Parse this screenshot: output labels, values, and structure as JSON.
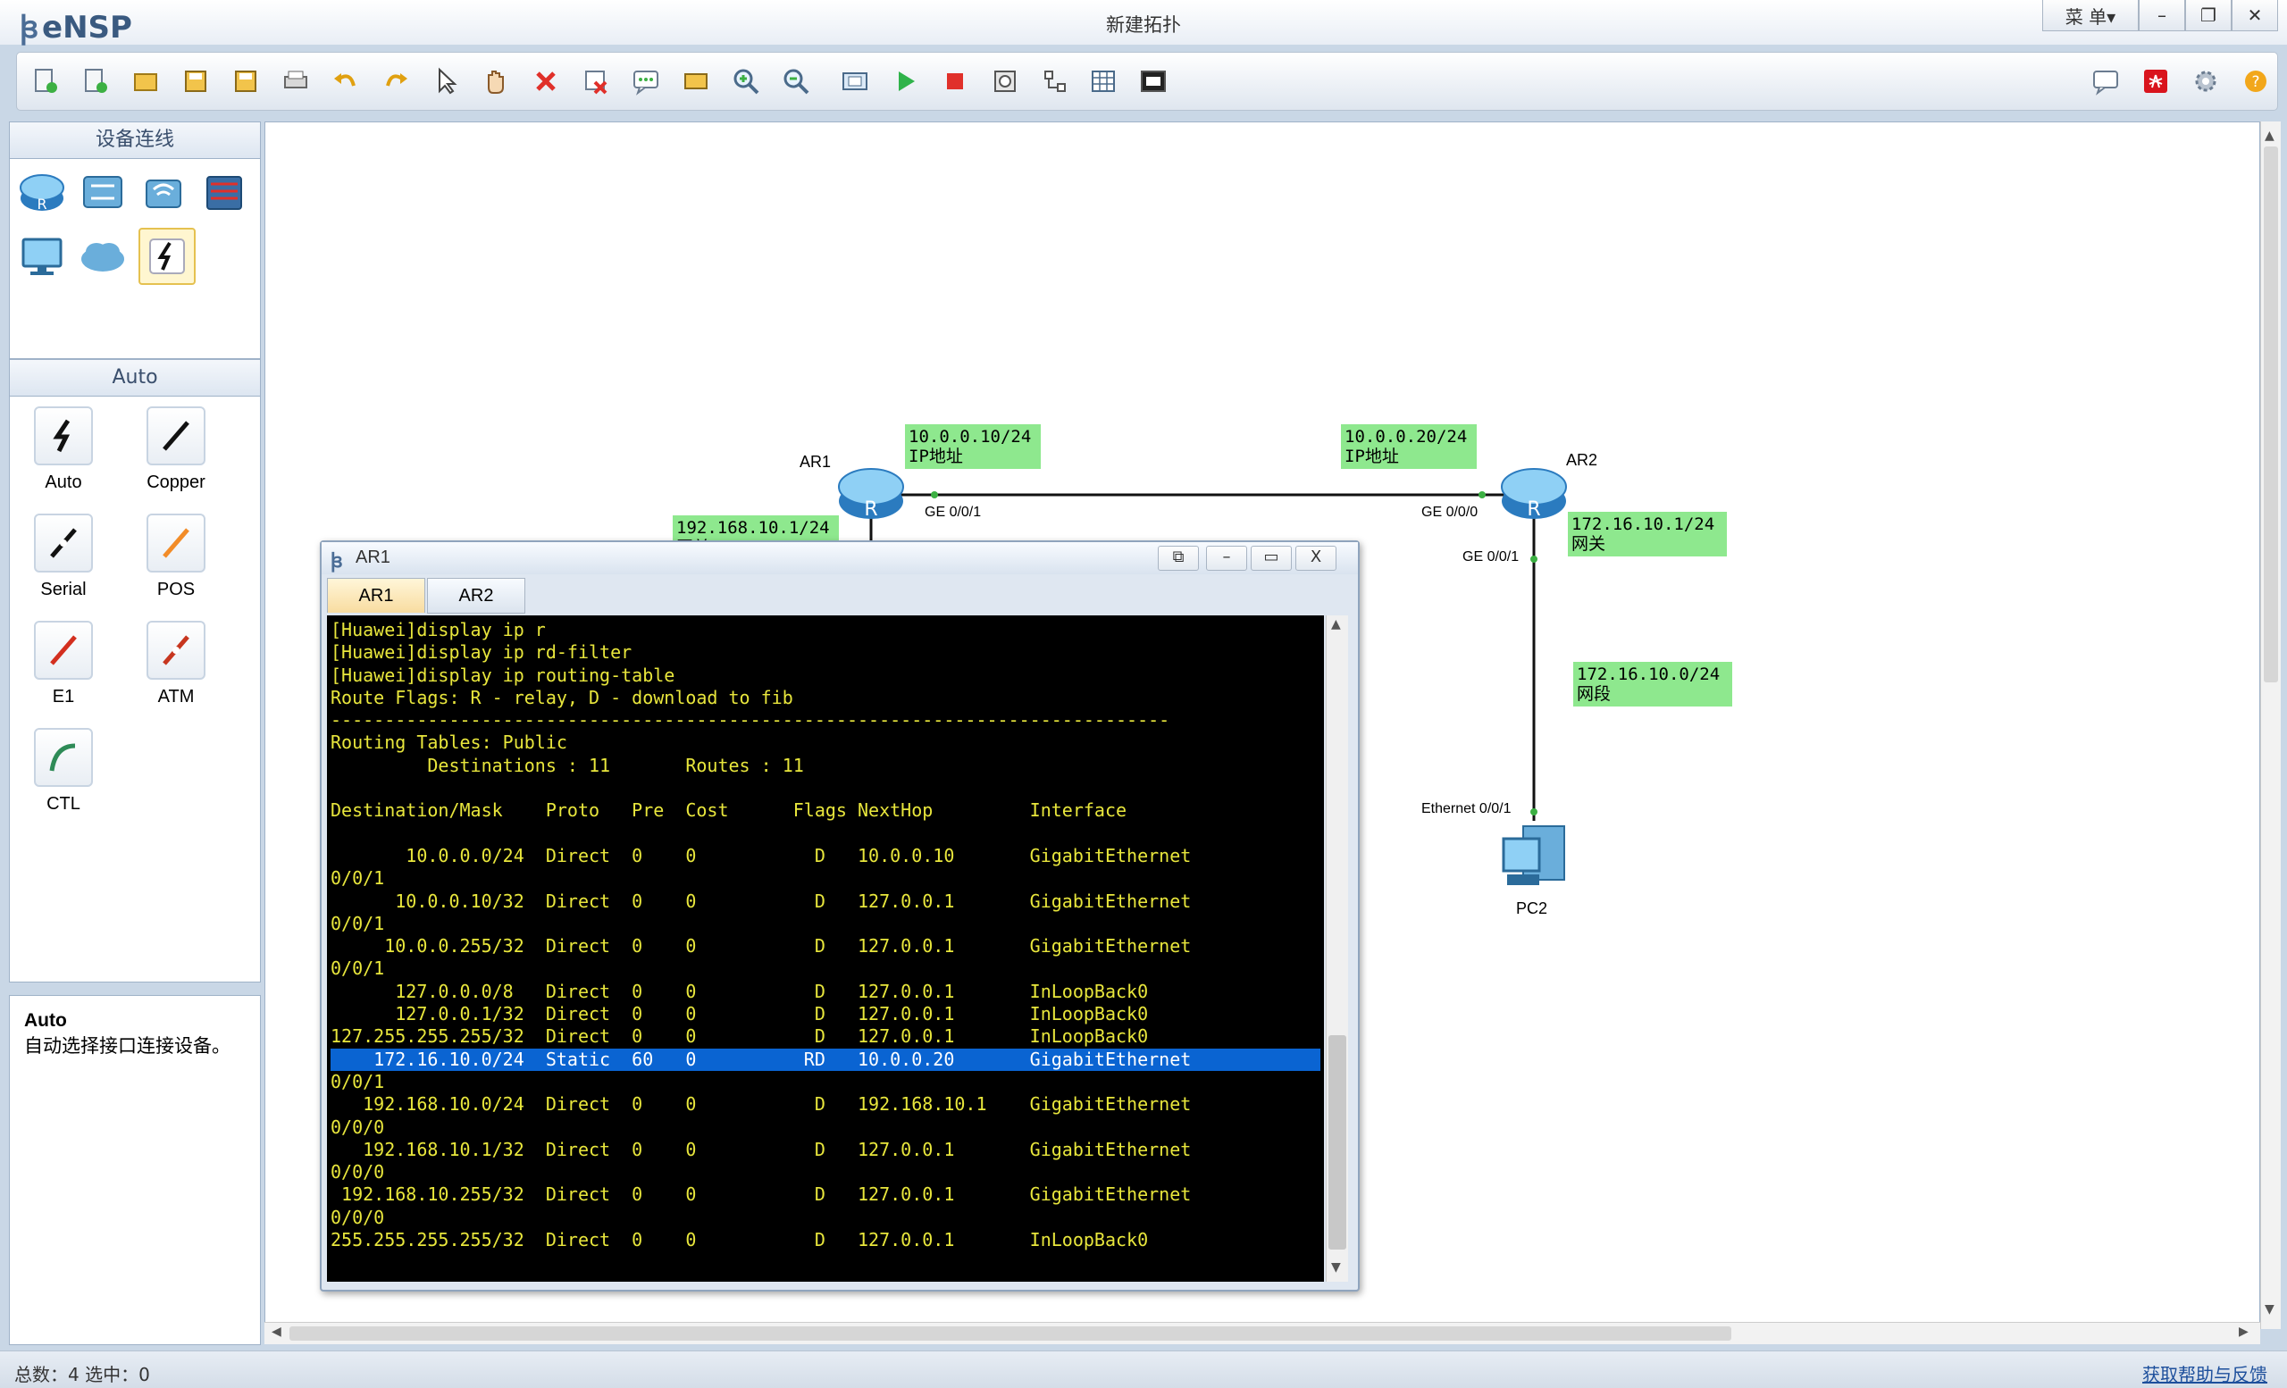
{
  "app": {
    "logo_text": "eNSP",
    "window_title": "新建拓扑",
    "menu_label": "菜 单▾",
    "minimize": "–",
    "restore": "❐",
    "close": "✕"
  },
  "toolbar": {
    "icons": [
      "new-topology-icon",
      "new-example-icon",
      "open-icon",
      "save-icon",
      "save-as-icon",
      "print-icon",
      "undo-icon",
      "redo-icon",
      "select-icon",
      "pan-hand-icon",
      "delete-icon",
      "delete-link-icon",
      "text-annotation-icon",
      "rectangle-icon",
      "zoom-in-icon",
      "zoom-out-icon",
      "fit-view-icon",
      "start-device-icon",
      "stop-device-icon",
      "capture-icon",
      "topology-icon",
      "grid-icon",
      "screenshot-icon",
      "chat-icon",
      "huawei-icon",
      "settings-icon",
      "help-icon"
    ]
  },
  "left_panel": {
    "device_header": "设备连线",
    "device_icons": [
      "router-icon",
      "switch-icon",
      "wlan-icon",
      "firewall-icon",
      "pc-icon",
      "cloud-icon",
      "cable-icon"
    ],
    "auto_header": "Auto",
    "cables": [
      {
        "label": "Auto",
        "icon": "auto-cable-icon",
        "color": "#111111"
      },
      {
        "label": "Copper",
        "icon": "copper-cable-icon",
        "color": "#111111"
      },
      {
        "label": "Serial",
        "icon": "serial-cable-icon",
        "color": "#111111"
      },
      {
        "label": "POS",
        "icon": "pos-cable-icon",
        "color": "#f28c28"
      },
      {
        "label": "E1",
        "icon": "e1-cable-icon",
        "color": "#d32f1f"
      },
      {
        "label": "ATM",
        "icon": "atm-cable-icon",
        "color": "#c7361f"
      },
      {
        "label": "CTL",
        "icon": "ctl-cable-icon",
        "color": "#2e8b57"
      }
    ],
    "desc_title": "Auto",
    "desc_text": "自动选择接口连接设备。"
  },
  "topology": {
    "devices": [
      {
        "name": "AR1",
        "icon": "router-icon"
      },
      {
        "name": "AR2",
        "icon": "router-icon"
      },
      {
        "name": "PC2",
        "icon": "pc-icon"
      }
    ],
    "labels": {
      "ar1_ip_line1": "10.0.0.10/24",
      "ar1_ip_line2": "IP地址",
      "ar2_ip_line1": "10.0.0.20/24",
      "ar2_ip_line2": "IP地址",
      "ar1_lan_line1": "192.168.10.1/24",
      "ar1_lan_line2": "网关",
      "ar2_gw_line1": "172.16.10.1/24",
      "ar2_gw_line2": "网关",
      "net_line1": "172.16.10.0/24",
      "net_line2": "网段"
    },
    "ports": {
      "ar1_ge001": "GE 0/0/1",
      "ar2_ge000": "GE 0/0/0",
      "ar2_ge001": "GE 0/0/1",
      "pc2_eth": "Ethernet 0/0/1"
    },
    "label_color": "#8ee88e"
  },
  "terminal": {
    "title": "AR1",
    "tabs": [
      "AR1",
      "AR2"
    ],
    "active_tab": "AR1",
    "lines": [
      "[Huawei]display ip r",
      "[Huawei]display ip rd-filter",
      "[Huawei]display ip routing-table",
      "Route Flags: R - relay, D - download to fib",
      "------------------------------------------------------------------------------",
      "Routing Tables: Public",
      "         Destinations : 11       Routes : 11",
      "",
      "Destination/Mask    Proto   Pre  Cost      Flags NextHop         Interface",
      "",
      "       10.0.0.0/24  Direct  0    0           D   10.0.0.10       GigabitEthernet",
      "0/0/1",
      "      10.0.0.10/32  Direct  0    0           D   127.0.0.1       GigabitEthernet",
      "0/0/1",
      "     10.0.0.255/32  Direct  0    0           D   127.0.0.1       GigabitEthernet",
      "0/0/1",
      "      127.0.0.0/8   Direct  0    0           D   127.0.0.1       InLoopBack0",
      "      127.0.0.1/32  Direct  0    0           D   127.0.0.1       InLoopBack0",
      "127.255.255.255/32  Direct  0    0           D   127.0.0.1       InLoopBack0",
      "    172.16.10.0/24  Static  60   0          RD   10.0.0.20       GigabitEthernet",
      "0/0/1",
      "   192.168.10.0/24  Direct  0    0           D   192.168.10.1    GigabitEthernet",
      "0/0/0",
      "   192.168.10.1/32  Direct  0    0           D   127.0.0.1       GigabitEthernet",
      "0/0/0",
      " 192.168.10.255/32  Direct  0    0           D   127.0.0.1       GigabitEthernet",
      "0/0/0",
      "255.255.255.255/32  Direct  0    0           D   127.0.0.1       InLoopBack0"
    ],
    "highlight_line": 19,
    "text_color": "#e8e63c",
    "highlight_color": "#0a64d2"
  },
  "status": {
    "left": "总数：4 选中：0",
    "help_link": "获取帮助与反馈"
  }
}
